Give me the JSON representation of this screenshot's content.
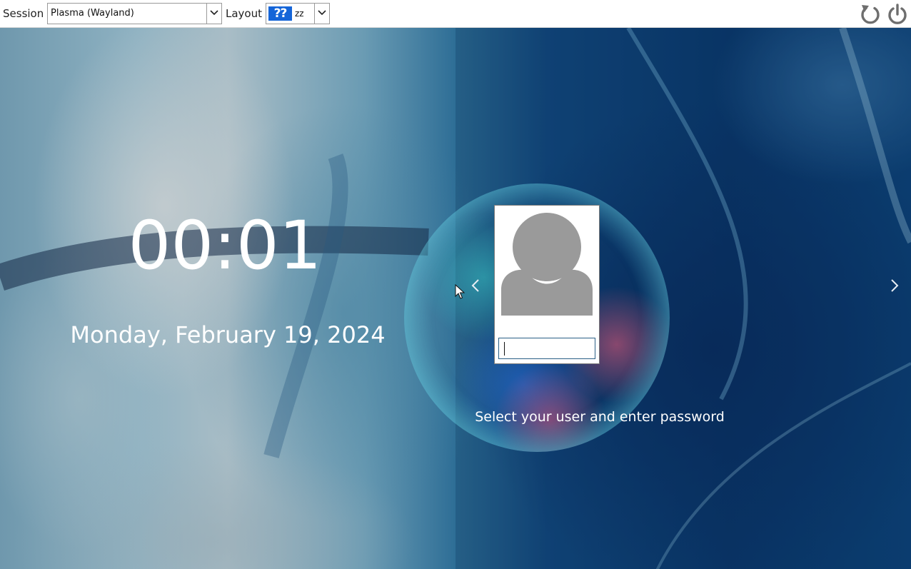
{
  "topbar": {
    "session_label": "Session",
    "session_value": "Plasma (Wayland)",
    "layout_label": "Layout",
    "layout_flag": "??",
    "layout_code": "zz",
    "icons": [
      "chevron-down-icon",
      "reboot-icon",
      "power-icon"
    ]
  },
  "clock": {
    "time": "00:01",
    "date": "Monday, February 19, 2024"
  },
  "login": {
    "password_value": "",
    "hint": "Select your user and enter password",
    "icons": [
      "chevron-left-icon",
      "chevron-right-icon",
      "user-avatar-icon"
    ]
  },
  "colors": {
    "topbar_bg": "#ffffff",
    "field_border": "#2a5f86",
    "avatar_gray": "#9a9a9a",
    "flag_blue": "#1565d8"
  }
}
